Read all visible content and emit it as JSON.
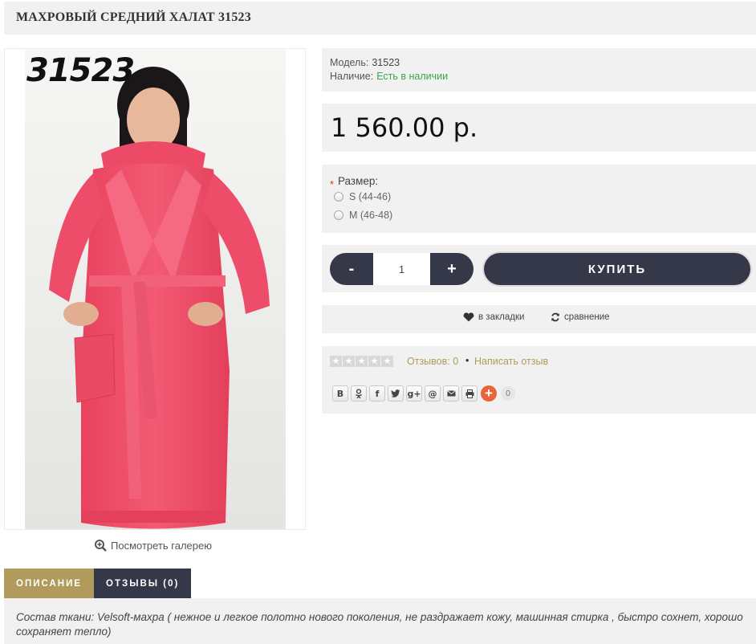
{
  "product": {
    "title": "МАХРОВЫЙ СРЕДНИЙ ХАЛАТ 31523",
    "photo_code": "31523",
    "gallery_label": "Посмотреть галерею"
  },
  "info": {
    "model_label": "Модель:",
    "model_value": "31523",
    "stock_label": "Наличие:",
    "stock_value": "Есть в наличии"
  },
  "price": "1 560.00 р.",
  "options": {
    "required_mark": "*",
    "size_label": "Размер:",
    "sizes": [
      "S (44-46)",
      "M (46-48)"
    ]
  },
  "purchase": {
    "minus": "-",
    "quantity": "1",
    "plus": "+",
    "buy_label": "КУПИТЬ"
  },
  "actions": {
    "wishlist_label": "в закладки",
    "compare_label": "сравнение"
  },
  "reviews": {
    "rating": 0,
    "count_label": "Отзывов: 0",
    "separator": "•",
    "write_label": "Написать отзыв"
  },
  "share": {
    "buttons": [
      "В",
      "ok",
      "f",
      "t",
      "g+",
      "@",
      "mail",
      "print"
    ],
    "count": "0"
  },
  "tabs": [
    {
      "label": "ОПИСАНИЕ",
      "active": true
    },
    {
      "label": "ОТЗЫВЫ (0)",
      "active": false
    }
  ],
  "description": "Состав ткани: Velsoft-махра ( нежное и легкое полотно нового поколения, не раздражает кожу, машинная стирка , быстро сохнет, хорошо сохраняет тепло)",
  "colors": {
    "dark_button": "#343848",
    "accent": "#b09a5c",
    "in_stock": "#3aa64a",
    "panel": "#f1f1f1",
    "robe": "#f0506a"
  }
}
